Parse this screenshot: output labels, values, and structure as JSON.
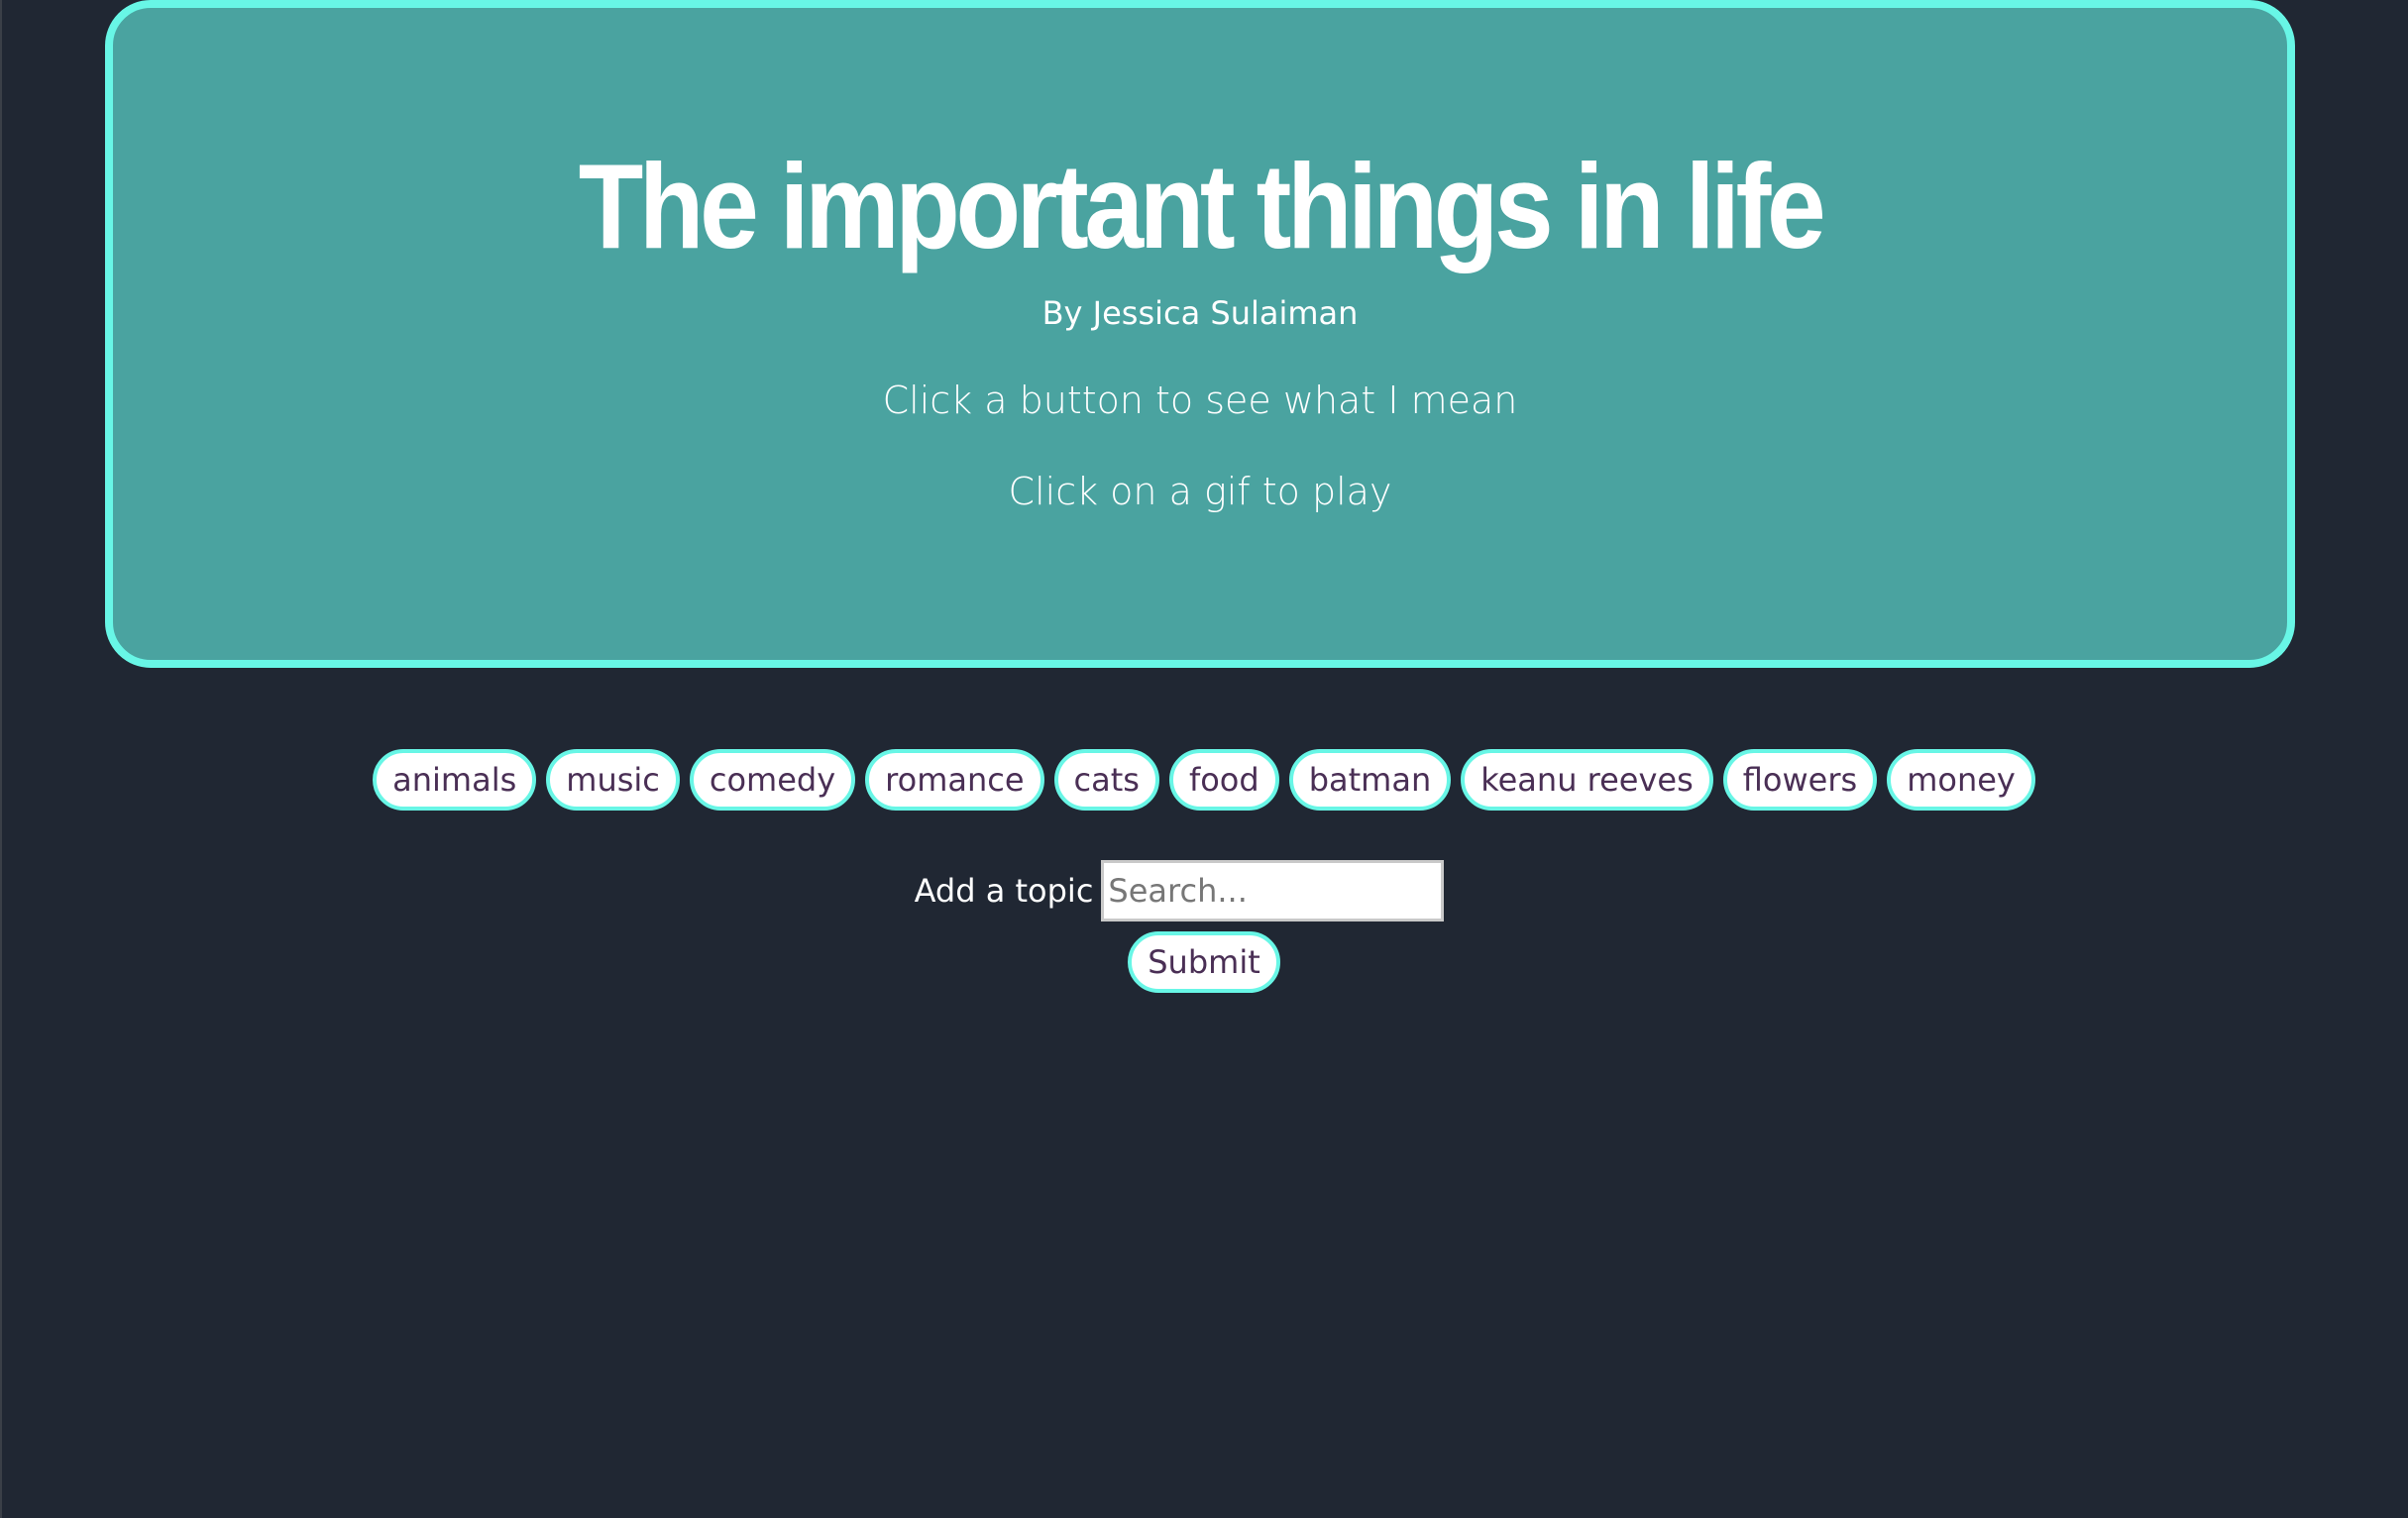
{
  "header": {
    "title": "The important things in life",
    "byline": "By Jessica Sulaiman",
    "instruction_1": "Click a button to see what I mean",
    "instruction_2": "Click on a gif to play"
  },
  "topics": [
    "animals",
    "music",
    "comedy",
    "romance",
    "cats",
    "food",
    "batman",
    "keanu reeves",
    "flowers",
    "money"
  ],
  "add_topic": {
    "label": "Add a topic",
    "placeholder": "Search...",
    "value": "",
    "submit_label": "Submit"
  },
  "colors": {
    "page_background": "#202733",
    "jumbotron_background": "#4aa3a0",
    "accent_border": "#68f6e6",
    "button_text": "#4a2f55"
  }
}
